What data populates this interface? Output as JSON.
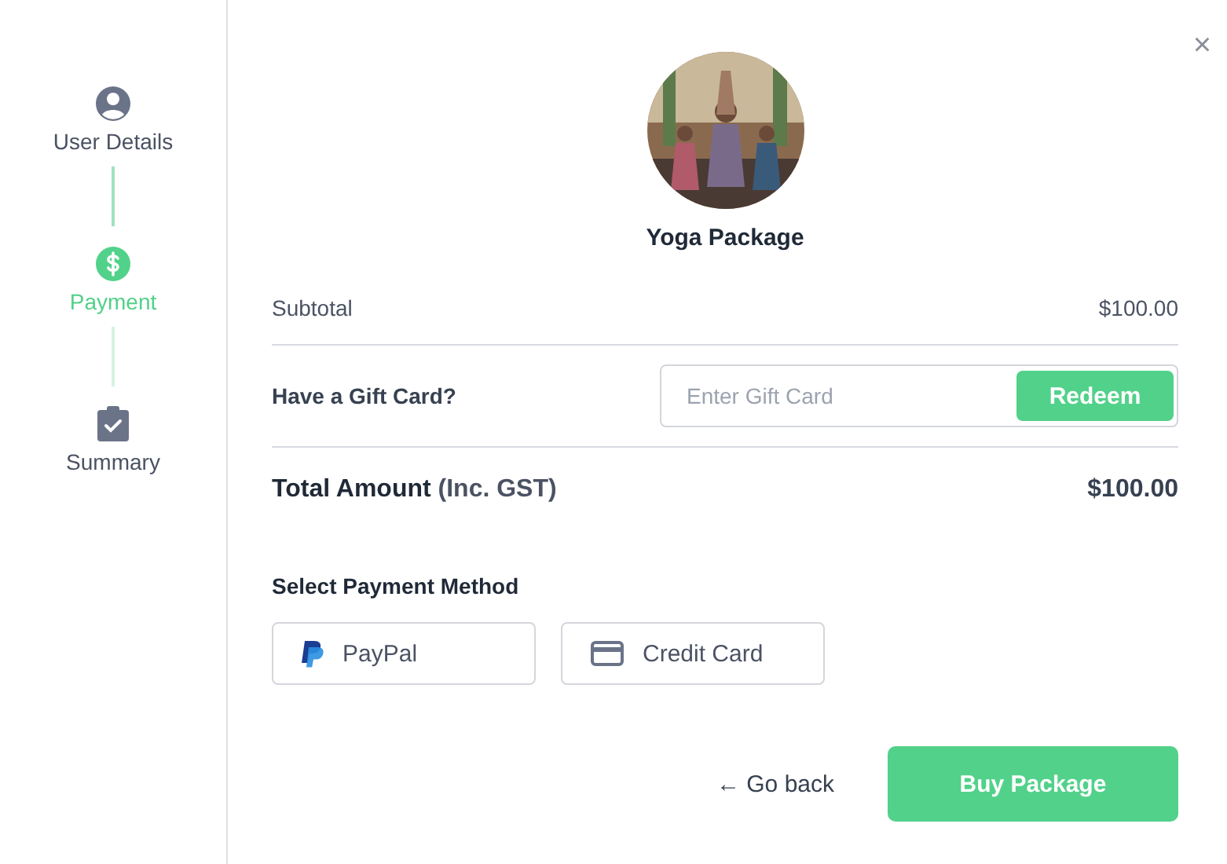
{
  "steps": [
    {
      "label": "User Details",
      "kind": "user",
      "selected": false
    },
    {
      "label": "Payment",
      "kind": "dollar",
      "selected": true
    },
    {
      "label": "Summary",
      "kind": "clipboard",
      "selected": false
    }
  ],
  "close": "×",
  "product": {
    "name": "Yoga Package"
  },
  "subtotal": {
    "label": "Subtotal",
    "value": "$100.00"
  },
  "gift_card": {
    "label": "Have a Gift Card?",
    "placeholder": "Enter Gift Card",
    "button": "Redeem"
  },
  "total": {
    "label": "Total Amount **(Inc. GST)**",
    "value": "$100.00"
  },
  "payment": {
    "heading": "Select Payment Method",
    "methods": [
      {
        "kind": "paypal",
        "label": "PayPal"
      },
      {
        "kind": "card",
        "label": "Credit Card"
      }
    ]
  },
  "actions": {
    "back": "← Go back",
    "buy": "Buy Package"
  }
}
